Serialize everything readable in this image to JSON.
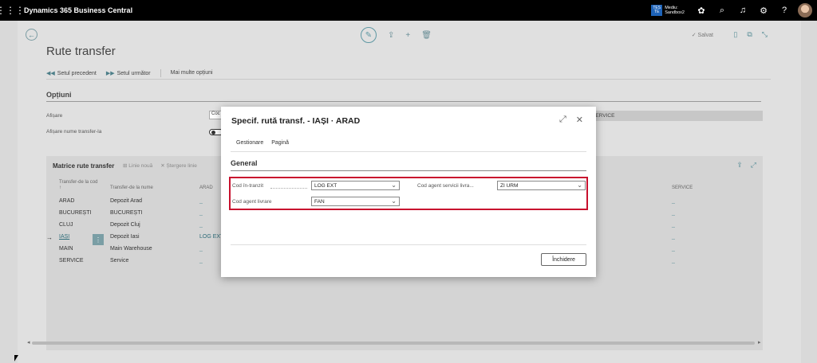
{
  "topbar": {
    "app_title": "Dynamics 365 Business Central",
    "env_badge": "TES TE",
    "env_line1": "Mediu:",
    "env_line2": "Sandbox2"
  },
  "page": {
    "title": "Rute transfer",
    "saved": "✓ Salvat",
    "actions": {
      "prev": "Setul precedent",
      "next": "Setul următor",
      "more": "Mai multe opțiuni"
    },
    "options_title": "Opțiuni",
    "afisare_label": "Afișare",
    "afisare_value": "Coc",
    "afisare_nume_label": "Afișare nume transfer-la",
    "right_field_value": "SERVICE"
  },
  "matrix": {
    "title": "Matrice rute transfer",
    "tools": [
      "Linie nouă",
      "Ștergere linie"
    ],
    "headers": {
      "code": "Transfer-de la cod ↑",
      "name": "Transfer-de la nume",
      "arad": "ARAD",
      "service": "SERVICE"
    },
    "rows": [
      {
        "code": "ARAD",
        "name": "Depozit Arad",
        "arad": "_",
        "service": "_"
      },
      {
        "code": "BUCUREȘTI",
        "name": "BUCUREȘTI",
        "arad": "_",
        "service": "_"
      },
      {
        "code": "CLUJ",
        "name": "Depozit Cluj",
        "arad": "_",
        "service": "_"
      },
      {
        "code": "IAȘI",
        "name": "Depozit Iasi",
        "arad": "LOG EXT",
        "service": "_"
      },
      {
        "code": "MAIN",
        "name": "Main Warehouse",
        "arad": "_",
        "service": "_"
      },
      {
        "code": "SERVICE",
        "name": "Service",
        "arad": "_",
        "service": "_"
      }
    ]
  },
  "modal": {
    "title": "Specif. rută transf. - IAȘI · ARAD",
    "tabs": [
      "Gestionare",
      "Pagină"
    ],
    "section": "General",
    "fields": {
      "cod_in_tranzit_label": "Cod în-tranzit",
      "cod_in_tranzit_value": "LOG EXT",
      "cod_agent_livrare_label": "Cod agent livrare",
      "cod_agent_livrare_value": "FAN",
      "cod_agent_servicii_label": "Cod agent servicii livra...",
      "cod_agent_servicii_value": "ZI URM"
    },
    "close_label": "Închidere"
  },
  "colors": {
    "accent": "#5f98a3",
    "highlight_border": "#c8102e",
    "topbar": "#000000"
  }
}
